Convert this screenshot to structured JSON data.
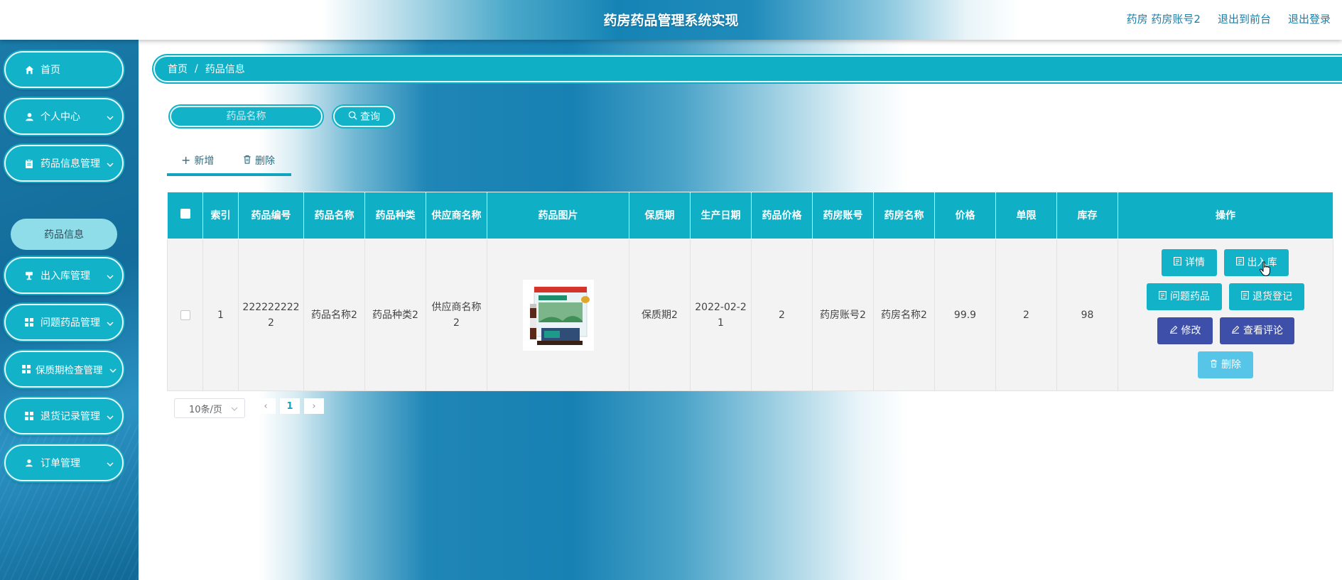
{
  "header": {
    "title": "药房药品管理系统实现",
    "links": [
      "药房 药房账号2",
      "退出到前台",
      "退出登录"
    ]
  },
  "sidebar": {
    "items": [
      {
        "label": "首页",
        "icon": "home-icon",
        "has_children": false
      },
      {
        "label": "个人中心",
        "icon": "user-icon",
        "has_children": true
      },
      {
        "label": "药品信息管理",
        "icon": "clipboard-icon",
        "has_children": true
      },
      {
        "label": "出入库管理",
        "icon": "drink-icon",
        "has_children": true
      },
      {
        "label": "问题药品管理",
        "icon": "grid-icon",
        "has_children": true
      },
      {
        "label": "保质期检查管理",
        "icon": "grid-icon",
        "has_children": true
      },
      {
        "label": "退货记录管理",
        "icon": "grid-icon",
        "has_children": true
      },
      {
        "label": "订单管理",
        "icon": "user-icon",
        "has_children": true
      }
    ],
    "active_submenu": "药品信息"
  },
  "breadcrumb": {
    "home": "首页",
    "separator": "/",
    "current": "药品信息"
  },
  "search": {
    "placeholder": "药品名称",
    "button_label": "查询"
  },
  "toolbar": {
    "add_label": "新增",
    "delete_label": "删除"
  },
  "table": {
    "columns": [
      "索引",
      "药品编号",
      "药品名称",
      "药品种类",
      "供应商名称",
      "药品图片",
      "保质期",
      "生产日期",
      "药品价格",
      "药房账号",
      "药房名称",
      "价格",
      "单限",
      "库存",
      "操作"
    ],
    "rows": [
      {
        "index": "1",
        "code": "2222222222",
        "name": "药品名称2",
        "category": "药品种类2",
        "supplier": "供应商名称2",
        "shelf_life": "保质期2",
        "production_date": "2022-02-21",
        "drug_price": "2",
        "pharmacy_account": "药房账号2",
        "pharmacy_name": "药房名称2",
        "price": "99.9",
        "limit": "2",
        "stock": "98"
      }
    ],
    "actions": {
      "detail": "详情",
      "inout": "出入库",
      "problem": "问题药品",
      "return": "退货登记",
      "edit": "修改",
      "review": "查看评论",
      "delete": "删除"
    }
  },
  "pagination": {
    "page_size": "10条/页",
    "current_page": "1",
    "prev": "‹",
    "next": "›"
  },
  "colors": {
    "accent": "#12b2c9",
    "indigo": "#3d4fa8",
    "light_blue": "#56c5e8",
    "sidebar": "#136c9b"
  }
}
